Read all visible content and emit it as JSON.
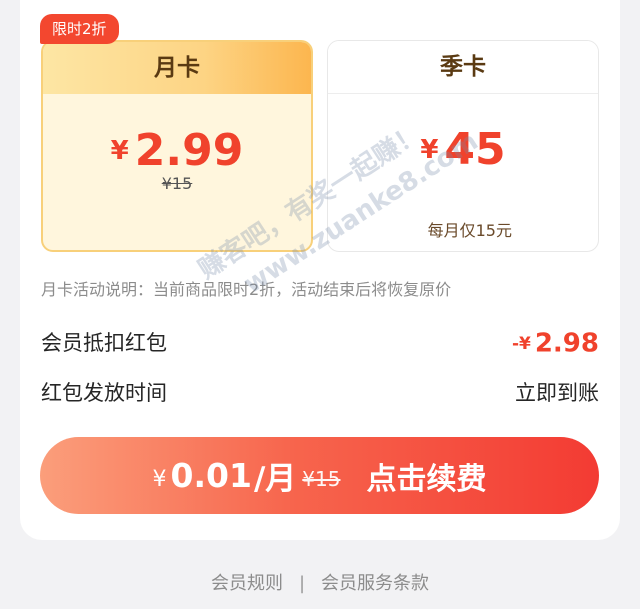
{
  "badge": "限时2折",
  "cards": {
    "monthly": {
      "title": "月卡",
      "currency": "¥",
      "price": "2.99",
      "original": "¥15"
    },
    "quarterly": {
      "title": "季卡",
      "currency": "¥",
      "price": "45",
      "note": "每月仅15元"
    }
  },
  "description": "月卡活动说明：当前商品限时2折，活动结束后将恢复原价",
  "rows": {
    "deduction": {
      "label": "会员抵扣红包",
      "prefix": "-¥",
      "amount": "2.98"
    },
    "timing": {
      "label": "红包发放时间",
      "value": "立即到账"
    }
  },
  "cta": {
    "currency": "¥",
    "amount": "0.01",
    "unit": "/月",
    "original": "¥15",
    "action": "点击续费"
  },
  "footer": {
    "rules": "会员规则",
    "separator": "|",
    "terms": "会员服务条款"
  },
  "watermark": {
    "line1": "赚客吧，有奖一起赚！",
    "line2": "www.zuanke8.com"
  },
  "colors": {
    "accent": "#f0422c",
    "gold": "#fcb64f"
  }
}
